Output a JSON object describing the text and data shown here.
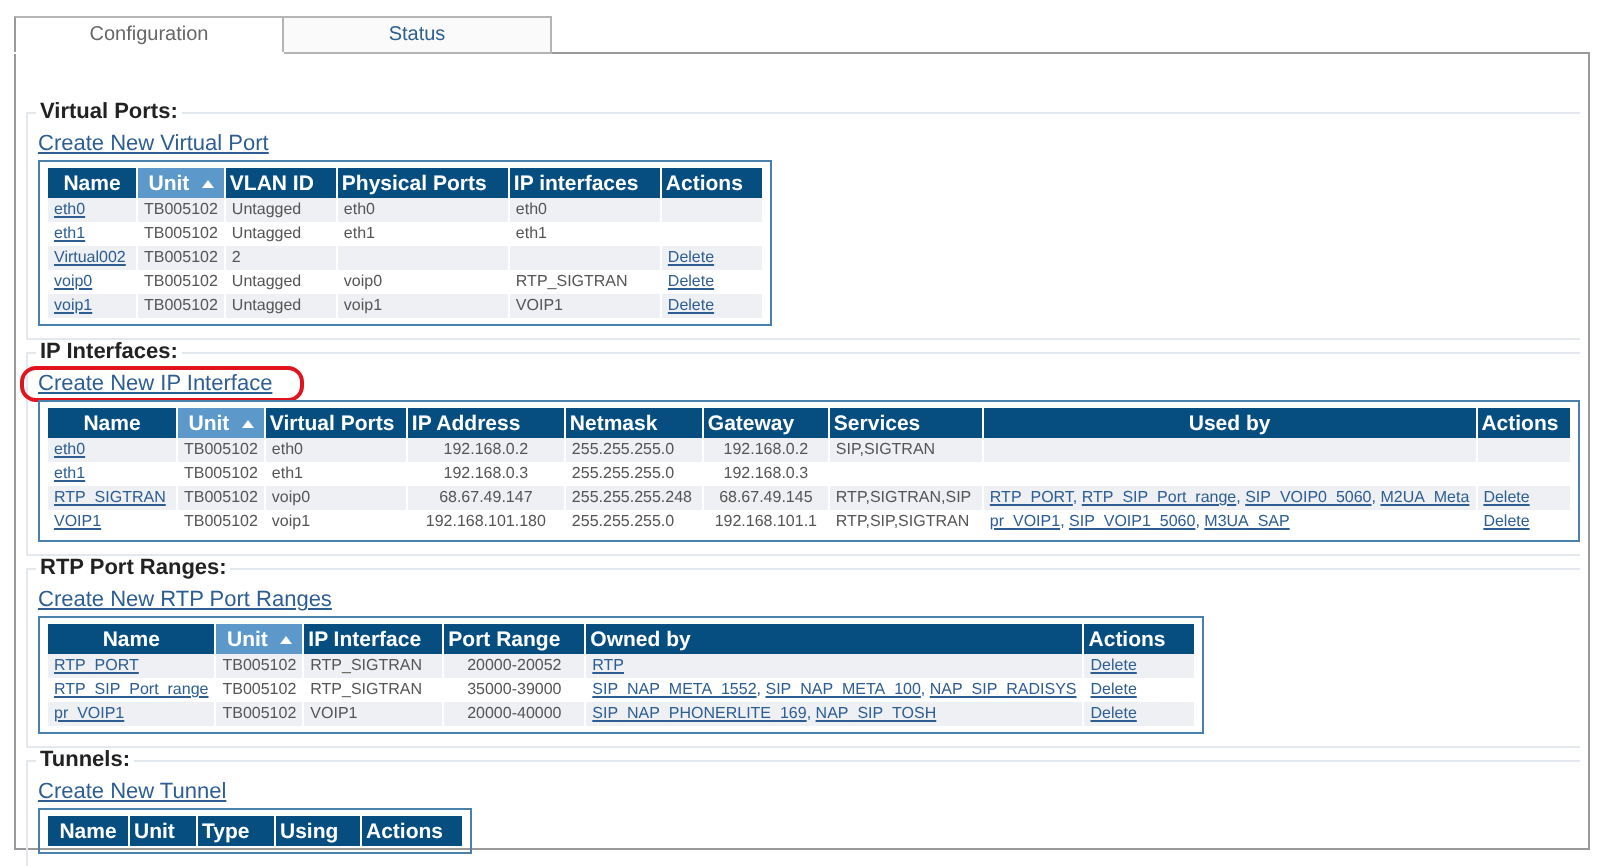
{
  "tabs": [
    {
      "label": "Configuration",
      "selected": true
    },
    {
      "label": "Status",
      "selected": false
    }
  ],
  "sections": [
    {
      "title": "Virtual Ports:",
      "create_link": "Create New Virtual Port",
      "highlighted": false,
      "columns": [
        {
          "label": "Name",
          "sorted": false
        },
        {
          "label": "Unit",
          "sorted": true
        },
        {
          "label": "VLAN ID",
          "sorted": false
        },
        {
          "label": "Physical Ports",
          "sorted": false
        },
        {
          "label": "IP interfaces",
          "sorted": false
        },
        {
          "label": "Actions",
          "sorted": false
        }
      ],
      "rows": [
        [
          {
            "kind": "link",
            "text": "eth0"
          },
          {
            "kind": "text",
            "text": "TB005102"
          },
          {
            "kind": "text",
            "text": "Untagged"
          },
          {
            "kind": "text",
            "text": "eth0"
          },
          {
            "kind": "text",
            "text": "eth0"
          },
          {
            "kind": "text",
            "text": ""
          }
        ],
        [
          {
            "kind": "link",
            "text": "eth1"
          },
          {
            "kind": "text",
            "text": "TB005102"
          },
          {
            "kind": "text",
            "text": "Untagged"
          },
          {
            "kind": "text",
            "text": "eth1"
          },
          {
            "kind": "text",
            "text": "eth1"
          },
          {
            "kind": "text",
            "text": ""
          }
        ],
        [
          {
            "kind": "link",
            "text": "Virtual002"
          },
          {
            "kind": "text",
            "text": "TB005102"
          },
          {
            "kind": "text",
            "text": "2"
          },
          {
            "kind": "text",
            "text": ""
          },
          {
            "kind": "text",
            "text": ""
          },
          {
            "kind": "link",
            "text": "Delete"
          }
        ],
        [
          {
            "kind": "link",
            "text": "voip0"
          },
          {
            "kind": "text",
            "text": "TB005102"
          },
          {
            "kind": "text",
            "text": "Untagged"
          },
          {
            "kind": "text",
            "text": "voip0"
          },
          {
            "kind": "text",
            "text": "RTP_SIGTRAN"
          },
          {
            "kind": "link",
            "text": "Delete"
          }
        ],
        [
          {
            "kind": "link",
            "text": "voip1"
          },
          {
            "kind": "text",
            "text": "TB005102"
          },
          {
            "kind": "text",
            "text": "Untagged"
          },
          {
            "kind": "text",
            "text": "voip1"
          },
          {
            "kind": "text",
            "text": "VOIP1"
          },
          {
            "kind": "link",
            "text": "Delete"
          }
        ]
      ]
    },
    {
      "title": "IP Interfaces:",
      "create_link": "Create New IP Interface",
      "highlighted": true,
      "columns": [
        {
          "label": "Name",
          "sorted": false
        },
        {
          "label": "Unit",
          "sorted": true
        },
        {
          "label": "Virtual Ports",
          "sorted": false
        },
        {
          "label": "IP Address",
          "sorted": false
        },
        {
          "label": "Netmask",
          "sorted": false
        },
        {
          "label": "Gateway",
          "sorted": false
        },
        {
          "label": "Services",
          "sorted": false
        },
        {
          "label": "Used by",
          "sorted": false
        },
        {
          "label": "Actions",
          "sorted": false
        }
      ],
      "rows": [
        [
          {
            "kind": "link",
            "text": "eth0"
          },
          {
            "kind": "text",
            "text": "TB005102"
          },
          {
            "kind": "text",
            "text": "eth0"
          },
          {
            "kind": "text",
            "text": "192.168.0.2"
          },
          {
            "kind": "text",
            "text": "255.255.255.0"
          },
          {
            "kind": "text",
            "text": "192.168.0.2"
          },
          {
            "kind": "text",
            "text": "SIP,SIGTRAN"
          },
          {
            "kind": "text",
            "text": ""
          },
          {
            "kind": "text",
            "text": ""
          }
        ],
        [
          {
            "kind": "link",
            "text": "eth1"
          },
          {
            "kind": "text",
            "text": "TB005102"
          },
          {
            "kind": "text",
            "text": "eth1"
          },
          {
            "kind": "text",
            "text": "192.168.0.3"
          },
          {
            "kind": "text",
            "text": "255.255.255.0"
          },
          {
            "kind": "text",
            "text": "192.168.0.3"
          },
          {
            "kind": "text",
            "text": ""
          },
          {
            "kind": "text",
            "text": ""
          },
          {
            "kind": "text",
            "text": ""
          }
        ],
        [
          {
            "kind": "link",
            "text": "RTP_SIGTRAN"
          },
          {
            "kind": "text",
            "text": "TB005102"
          },
          {
            "kind": "text",
            "text": "voip0"
          },
          {
            "kind": "text",
            "text": "68.67.49.147"
          },
          {
            "kind": "text",
            "text": "255.255.255.248"
          },
          {
            "kind": "text",
            "text": "68.67.49.145"
          },
          {
            "kind": "text",
            "text": "RTP,SIGTRAN,SIP"
          },
          {
            "kind": "links",
            "separator": ",",
            "items": [
              "RTP_PORT",
              "RTP_SIP_Port_range",
              "SIP_VOIP0_5060",
              "M2UA_Meta"
            ]
          },
          {
            "kind": "link",
            "text": "Delete"
          }
        ],
        [
          {
            "kind": "link",
            "text": "VOIP1"
          },
          {
            "kind": "text",
            "text": "TB005102"
          },
          {
            "kind": "text",
            "text": "voip1"
          },
          {
            "kind": "text",
            "text": "192.168.101.180"
          },
          {
            "kind": "text",
            "text": "255.255.255.0"
          },
          {
            "kind": "text",
            "text": "192.168.101.1"
          },
          {
            "kind": "text",
            "text": "RTP,SIP,SIGTRAN"
          },
          {
            "kind": "links",
            "separator": ",",
            "items": [
              "pr_VOIP1",
              "SIP_VOIP1_5060",
              "M3UA_SAP"
            ]
          },
          {
            "kind": "link",
            "text": "Delete"
          }
        ]
      ]
    },
    {
      "title": "RTP Port Ranges:",
      "create_link": "Create New RTP Port Ranges",
      "highlighted": false,
      "columns": [
        {
          "label": "Name",
          "sorted": false
        },
        {
          "label": "Unit",
          "sorted": true
        },
        {
          "label": "IP Interface",
          "sorted": false
        },
        {
          "label": "Port Range",
          "sorted": false
        },
        {
          "label": "Owned by",
          "sorted": false
        },
        {
          "label": "Actions",
          "sorted": false
        }
      ],
      "rows": [
        [
          {
            "kind": "link",
            "text": "RTP_PORT"
          },
          {
            "kind": "text",
            "text": "TB005102"
          },
          {
            "kind": "text",
            "text": "RTP_SIGTRAN"
          },
          {
            "kind": "text",
            "text": "20000-20052"
          },
          {
            "kind": "link",
            "text": "RTP"
          },
          {
            "kind": "link",
            "text": "Delete"
          }
        ],
        [
          {
            "kind": "link",
            "text": "RTP_SIP_Port_range"
          },
          {
            "kind": "text",
            "text": "TB005102"
          },
          {
            "kind": "text",
            "text": "RTP_SIGTRAN"
          },
          {
            "kind": "text",
            "text": "35000-39000"
          },
          {
            "kind": "links",
            "separator": ",",
            "items": [
              "SIP_NAP_META_1552",
              "SIP_NAP_META_100",
              "NAP_SIP_RADISYS"
            ]
          },
          {
            "kind": "link",
            "text": "Delete"
          }
        ],
        [
          {
            "kind": "link",
            "text": "pr_VOIP1"
          },
          {
            "kind": "text",
            "text": "TB005102"
          },
          {
            "kind": "text",
            "text": "VOIP1"
          },
          {
            "kind": "text",
            "text": "20000-40000"
          },
          {
            "kind": "links",
            "separator": ",",
            "items": [
              "SIP_NAP_PHONERLITE_169",
              "NAP_SIP_TOSH"
            ]
          },
          {
            "kind": "link",
            "text": "Delete"
          }
        ]
      ]
    },
    {
      "title": "Tunnels:",
      "create_link": "Create New Tunnel",
      "highlighted": false,
      "columns": [
        {
          "label": "Name",
          "sorted": false
        },
        {
          "label": "Unit",
          "sorted": false
        },
        {
          "label": "Type",
          "sorted": false
        },
        {
          "label": "Using",
          "sorted": false
        },
        {
          "label": "Actions",
          "sorted": false
        }
      ]
    }
  ]
}
